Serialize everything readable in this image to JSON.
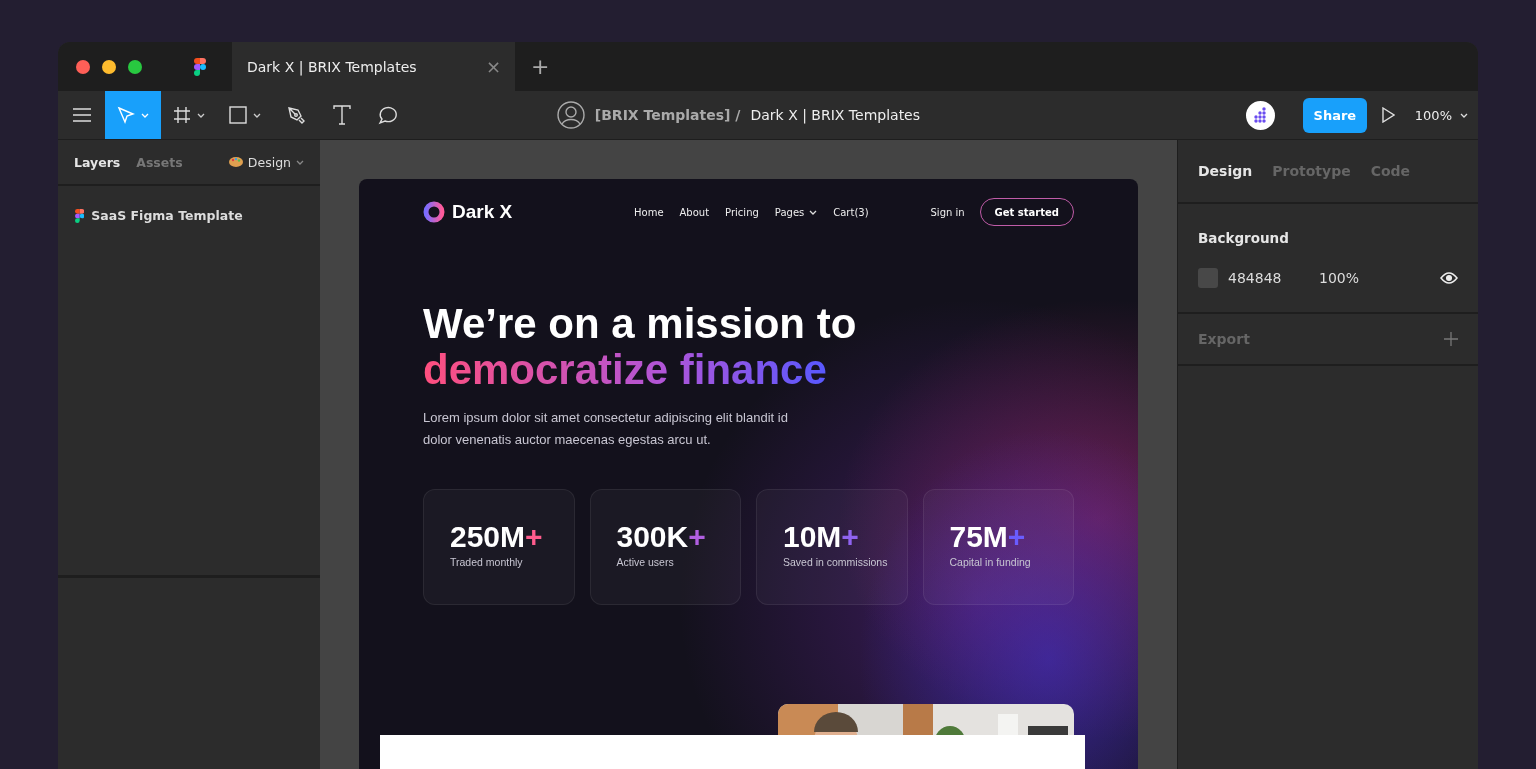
{
  "window": {
    "tab": {
      "title": "Dark X | BRIX Templates",
      "close": "×"
    },
    "new_tab": "+"
  },
  "toolbar": {
    "tools": [
      {
        "kind": "move",
        "selected": true,
        "dropdown": true
      },
      {
        "kind": "frame",
        "selected": false,
        "dropdown": true
      },
      {
        "kind": "shape",
        "selected": false,
        "dropdown": true
      },
      {
        "kind": "pen",
        "selected": false,
        "dropdown": false
      },
      {
        "kind": "text",
        "selected": false,
        "dropdown": false
      },
      {
        "kind": "comment",
        "selected": false,
        "dropdown": false
      }
    ],
    "team": "[BRIX Templates] /",
    "file": "Dark X | BRIX Templates",
    "share": "Share",
    "zoom": "100%"
  },
  "left_panel": {
    "tabs": [
      {
        "label": "Layers",
        "selected": true
      },
      {
        "label": "Assets",
        "selected": false
      }
    ],
    "page_menu": "Design",
    "layers": [
      {
        "name": "SaaS Figma Template"
      }
    ]
  },
  "right_panel": {
    "tabs": [
      {
        "label": "Design",
        "selected": true
      },
      {
        "label": "Prototype",
        "selected": false
      },
      {
        "label": "Code",
        "selected": false
      }
    ],
    "background": {
      "title": "Background",
      "hex": "484848",
      "opacity": "100%",
      "visible": true
    },
    "export": {
      "title": "Export"
    }
  },
  "frame": {
    "logo": "Dark X",
    "nav": [
      {
        "label": "Home",
        "dropdown": false
      },
      {
        "label": "About",
        "dropdown": false
      },
      {
        "label": "Pricing",
        "dropdown": false
      },
      {
        "label": "Pages",
        "dropdown": true
      },
      {
        "label": "Cart(3)",
        "dropdown": false
      }
    ],
    "sign_in": "Sign in",
    "cta": "Get started",
    "heading": "We’re on a mission to",
    "heading_accent": "democratize finance",
    "body": "Lorem ipsum dolor sit amet consectetur adipiscing elit blandit id dolor venenatis auctor maecenas egestas arcu ut.",
    "stats": [
      {
        "value": "250M",
        "suffix": "+",
        "color": "#ff5c8d",
        "label": "Traded monthly"
      },
      {
        "value": "300K",
        "suffix": "+",
        "color": "#b05fe0",
        "label": "Active users"
      },
      {
        "value": "10M",
        "suffix": "+",
        "color": "#8f63f0",
        "label": "Saved in commissions"
      },
      {
        "value": "75M",
        "suffix": "+",
        "color": "#6a5cff",
        "label": "Capital in funding"
      }
    ]
  }
}
